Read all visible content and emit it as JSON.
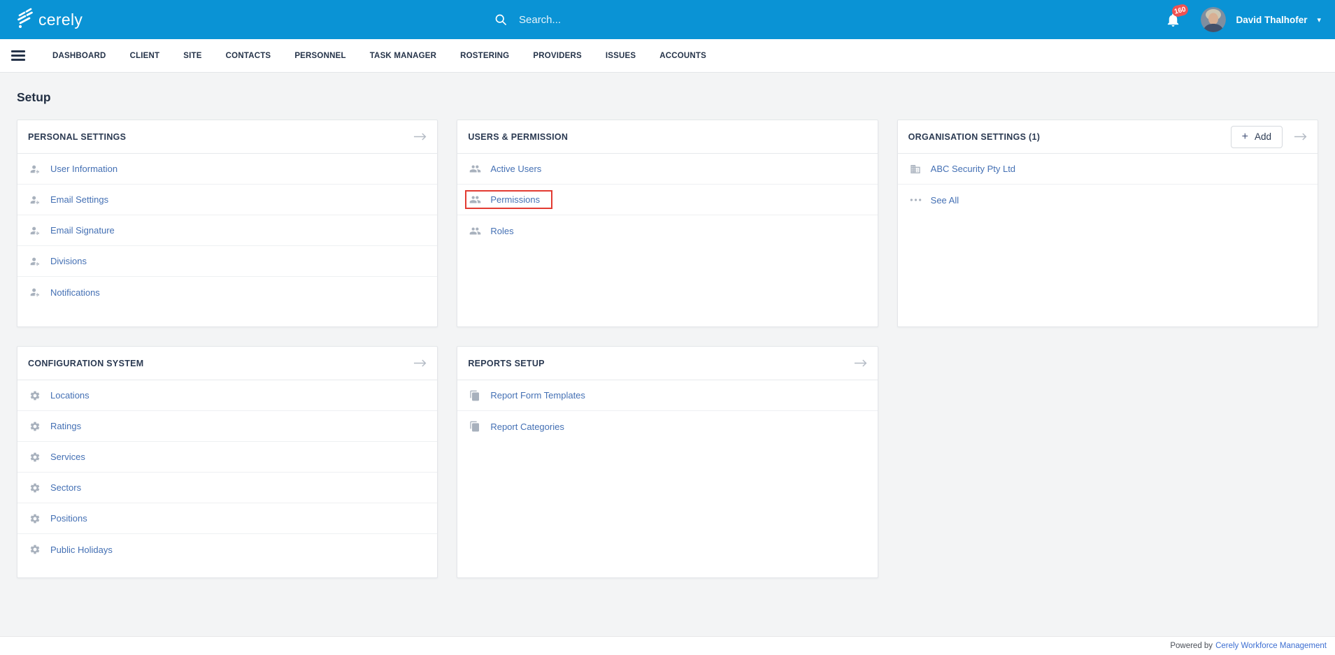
{
  "topbar": {
    "brand": "cerely",
    "search_placeholder": "Search...",
    "notification_count": "160",
    "user_name": "David Thalhofer"
  },
  "nav": {
    "items": [
      "DASHBOARD",
      "CLIENT",
      "SITE",
      "CONTACTS",
      "PERSONNEL",
      "TASK MANAGER",
      "ROSTERING",
      "PROVIDERS",
      "ISSUES",
      "ACCOUNTS"
    ]
  },
  "page": {
    "title": "Setup"
  },
  "cards": [
    {
      "id": "personal-settings",
      "title": "PERSONAL SETTINGS",
      "has_arrow": true,
      "grid": "1 / 1",
      "items": [
        {
          "label": "User Information",
          "icon": "user-gear"
        },
        {
          "label": "Email Settings",
          "icon": "user-gear"
        },
        {
          "label": "Email Signature",
          "icon": "user-gear"
        },
        {
          "label": "Divisions",
          "icon": "user-gear"
        },
        {
          "label": "Notifications",
          "icon": "user-gear"
        }
      ]
    },
    {
      "id": "users-permission",
      "title": "USERS & PERMISSION",
      "has_arrow": false,
      "grid": "1 / 2",
      "items": [
        {
          "label": "Active Users",
          "icon": "users"
        },
        {
          "label": "Permissions",
          "icon": "users",
          "highlighted": true
        },
        {
          "label": "Roles",
          "icon": "users"
        }
      ]
    },
    {
      "id": "organisation-settings",
      "title": "ORGANISATION SETTINGS (1)",
      "has_arrow": true,
      "add_button": "Add",
      "grid": "1 / 3",
      "items": [
        {
          "label": "ABC Security Pty Ltd",
          "icon": "building"
        },
        {
          "label": "See All",
          "icon": "ellipsis"
        }
      ]
    },
    {
      "id": "configuration-system",
      "title": "CONFIGURATION SYSTEM",
      "has_arrow": true,
      "grid": "2 / 1",
      "items": [
        {
          "label": "Locations",
          "icon": "gear"
        },
        {
          "label": "Ratings",
          "icon": "gear"
        },
        {
          "label": "Services",
          "icon": "gear"
        },
        {
          "label": "Sectors",
          "icon": "gear"
        },
        {
          "label": "Positions",
          "icon": "gear"
        },
        {
          "label": "Public Holidays",
          "icon": "gear"
        }
      ]
    },
    {
      "id": "reports-setup",
      "title": "REPORTS SETUP",
      "has_arrow": true,
      "grid": "2 / 2",
      "items": [
        {
          "label": "Report Form Templates",
          "icon": "documents"
        },
        {
          "label": "Report Categories",
          "icon": "documents"
        }
      ]
    }
  ],
  "footer": {
    "prefix": "Powered by",
    "link": "Cerely Workforce Management"
  },
  "colors": {
    "brand_blue": "#0a93d5",
    "link_blue": "#4470b4",
    "highlight_red": "#e23b32",
    "badge_red": "#f05252"
  }
}
